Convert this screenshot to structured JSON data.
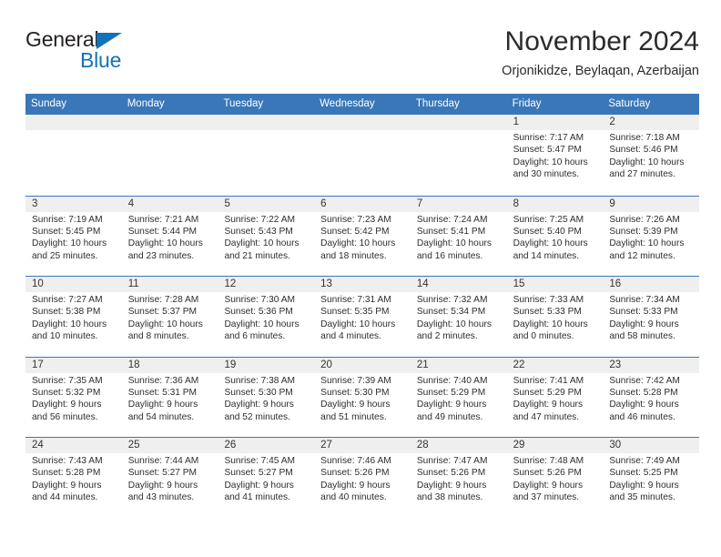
{
  "brand": {
    "name_top": "General",
    "name_bottom": "Blue",
    "triangle_icon": "triangle-icon",
    "accent_color": "#1273b9"
  },
  "header": {
    "month_title": "November 2024",
    "location": "Orjonikidze, Beylaqan, Azerbaijan"
  },
  "calendar": {
    "header_color": "#3a77b8",
    "date_band_color": "#efefef",
    "weekdays": [
      "Sunday",
      "Monday",
      "Tuesday",
      "Wednesday",
      "Thursday",
      "Friday",
      "Saturday"
    ],
    "weeks": [
      [
        {
          "day": "",
          "lines": []
        },
        {
          "day": "",
          "lines": []
        },
        {
          "day": "",
          "lines": []
        },
        {
          "day": "",
          "lines": []
        },
        {
          "day": "",
          "lines": []
        },
        {
          "day": "1",
          "lines": [
            "Sunrise: 7:17 AM",
            "Sunset: 5:47 PM",
            "Daylight: 10 hours",
            "and 30 minutes."
          ]
        },
        {
          "day": "2",
          "lines": [
            "Sunrise: 7:18 AM",
            "Sunset: 5:46 PM",
            "Daylight: 10 hours",
            "and 27 minutes."
          ]
        }
      ],
      [
        {
          "day": "3",
          "lines": [
            "Sunrise: 7:19 AM",
            "Sunset: 5:45 PM",
            "Daylight: 10 hours",
            "and 25 minutes."
          ]
        },
        {
          "day": "4",
          "lines": [
            "Sunrise: 7:21 AM",
            "Sunset: 5:44 PM",
            "Daylight: 10 hours",
            "and 23 minutes."
          ]
        },
        {
          "day": "5",
          "lines": [
            "Sunrise: 7:22 AM",
            "Sunset: 5:43 PM",
            "Daylight: 10 hours",
            "and 21 minutes."
          ]
        },
        {
          "day": "6",
          "lines": [
            "Sunrise: 7:23 AM",
            "Sunset: 5:42 PM",
            "Daylight: 10 hours",
            "and 18 minutes."
          ]
        },
        {
          "day": "7",
          "lines": [
            "Sunrise: 7:24 AM",
            "Sunset: 5:41 PM",
            "Daylight: 10 hours",
            "and 16 minutes."
          ]
        },
        {
          "day": "8",
          "lines": [
            "Sunrise: 7:25 AM",
            "Sunset: 5:40 PM",
            "Daylight: 10 hours",
            "and 14 minutes."
          ]
        },
        {
          "day": "9",
          "lines": [
            "Sunrise: 7:26 AM",
            "Sunset: 5:39 PM",
            "Daylight: 10 hours",
            "and 12 minutes."
          ]
        }
      ],
      [
        {
          "day": "10",
          "lines": [
            "Sunrise: 7:27 AM",
            "Sunset: 5:38 PM",
            "Daylight: 10 hours",
            "and 10 minutes."
          ]
        },
        {
          "day": "11",
          "lines": [
            "Sunrise: 7:28 AM",
            "Sunset: 5:37 PM",
            "Daylight: 10 hours",
            "and 8 minutes."
          ]
        },
        {
          "day": "12",
          "lines": [
            "Sunrise: 7:30 AM",
            "Sunset: 5:36 PM",
            "Daylight: 10 hours",
            "and 6 minutes."
          ]
        },
        {
          "day": "13",
          "lines": [
            "Sunrise: 7:31 AM",
            "Sunset: 5:35 PM",
            "Daylight: 10 hours",
            "and 4 minutes."
          ]
        },
        {
          "day": "14",
          "lines": [
            "Sunrise: 7:32 AM",
            "Sunset: 5:34 PM",
            "Daylight: 10 hours",
            "and 2 minutes."
          ]
        },
        {
          "day": "15",
          "lines": [
            "Sunrise: 7:33 AM",
            "Sunset: 5:33 PM",
            "Daylight: 10 hours",
            "and 0 minutes."
          ]
        },
        {
          "day": "16",
          "lines": [
            "Sunrise: 7:34 AM",
            "Sunset: 5:33 PM",
            "Daylight: 9 hours",
            "and 58 minutes."
          ]
        }
      ],
      [
        {
          "day": "17",
          "lines": [
            "Sunrise: 7:35 AM",
            "Sunset: 5:32 PM",
            "Daylight: 9 hours",
            "and 56 minutes."
          ]
        },
        {
          "day": "18",
          "lines": [
            "Sunrise: 7:36 AM",
            "Sunset: 5:31 PM",
            "Daylight: 9 hours",
            "and 54 minutes."
          ]
        },
        {
          "day": "19",
          "lines": [
            "Sunrise: 7:38 AM",
            "Sunset: 5:30 PM",
            "Daylight: 9 hours",
            "and 52 minutes."
          ]
        },
        {
          "day": "20",
          "lines": [
            "Sunrise: 7:39 AM",
            "Sunset: 5:30 PM",
            "Daylight: 9 hours",
            "and 51 minutes."
          ]
        },
        {
          "day": "21",
          "lines": [
            "Sunrise: 7:40 AM",
            "Sunset: 5:29 PM",
            "Daylight: 9 hours",
            "and 49 minutes."
          ]
        },
        {
          "day": "22",
          "lines": [
            "Sunrise: 7:41 AM",
            "Sunset: 5:29 PM",
            "Daylight: 9 hours",
            "and 47 minutes."
          ]
        },
        {
          "day": "23",
          "lines": [
            "Sunrise: 7:42 AM",
            "Sunset: 5:28 PM",
            "Daylight: 9 hours",
            "and 46 minutes."
          ]
        }
      ],
      [
        {
          "day": "24",
          "lines": [
            "Sunrise: 7:43 AM",
            "Sunset: 5:28 PM",
            "Daylight: 9 hours",
            "and 44 minutes."
          ]
        },
        {
          "day": "25",
          "lines": [
            "Sunrise: 7:44 AM",
            "Sunset: 5:27 PM",
            "Daylight: 9 hours",
            "and 43 minutes."
          ]
        },
        {
          "day": "26",
          "lines": [
            "Sunrise: 7:45 AM",
            "Sunset: 5:27 PM",
            "Daylight: 9 hours",
            "and 41 minutes."
          ]
        },
        {
          "day": "27",
          "lines": [
            "Sunrise: 7:46 AM",
            "Sunset: 5:26 PM",
            "Daylight: 9 hours",
            "and 40 minutes."
          ]
        },
        {
          "day": "28",
          "lines": [
            "Sunrise: 7:47 AM",
            "Sunset: 5:26 PM",
            "Daylight: 9 hours",
            "and 38 minutes."
          ]
        },
        {
          "day": "29",
          "lines": [
            "Sunrise: 7:48 AM",
            "Sunset: 5:26 PM",
            "Daylight: 9 hours",
            "and 37 minutes."
          ]
        },
        {
          "day": "30",
          "lines": [
            "Sunrise: 7:49 AM",
            "Sunset: 5:25 PM",
            "Daylight: 9 hours",
            "and 35 minutes."
          ]
        }
      ]
    ]
  }
}
